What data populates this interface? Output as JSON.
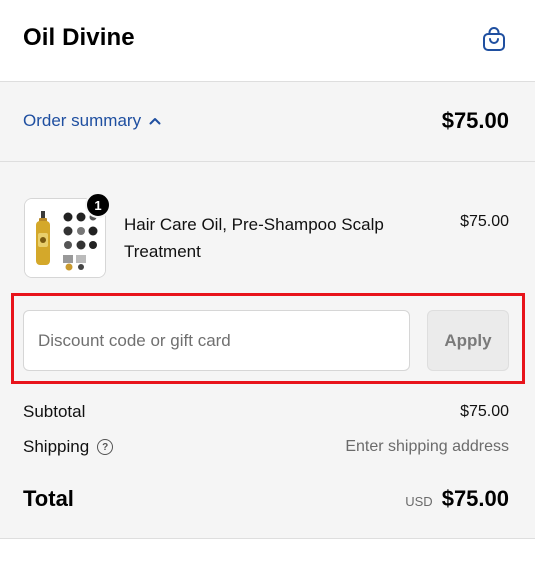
{
  "header": {
    "brand": "Oil Divine",
    "cart_icon": "shopping-bag-icon",
    "accent_color": "#1f4fa0"
  },
  "summary_bar": {
    "toggle_label": "Order summary",
    "toggle_icon": "chevron-up-icon",
    "price": "$75.00"
  },
  "line_item": {
    "quantity": "1",
    "name": "Hair Care Oil, Pre-Shampoo Scalp Treatment",
    "price": "$75.00"
  },
  "discount": {
    "placeholder": "Discount code or gift card",
    "value": "",
    "apply_label": "Apply",
    "highlight_color": "#e8141b"
  },
  "totals": {
    "subtotal_label": "Subtotal",
    "subtotal_value": "$75.00",
    "shipping_label": "Shipping",
    "shipping_icon": "question-circle-icon",
    "shipping_value": "Enter shipping address",
    "total_label": "Total",
    "currency": "USD",
    "total_value": "$75.00"
  }
}
